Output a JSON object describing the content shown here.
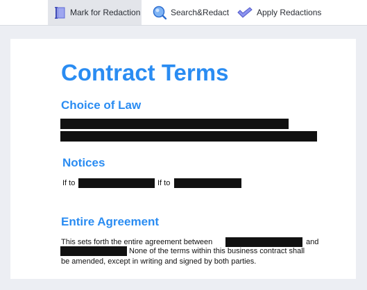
{
  "toolbar": {
    "mark_label": "Mark for Redaction",
    "search_label": "Search&Redact",
    "apply_label": "Apply Redactions",
    "accent": "#2a8cf2"
  },
  "document": {
    "title": "Contract Terms",
    "sections": {
      "choice_of_law": {
        "heading": "Choice of Law"
      },
      "notices": {
        "heading": "Notices",
        "if_to_1": "If to",
        "if_to_2": "If to"
      },
      "entire_agreement": {
        "heading": "Entire Agreement",
        "line1_a": "This sets forth the entire agreement between",
        "line1_b": "and",
        "line2": "None of the terms within this business contract shall",
        "line3": "be amended, except in writing and signed by both parties."
      }
    }
  }
}
